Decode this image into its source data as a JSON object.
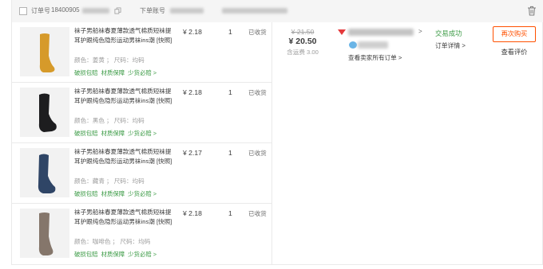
{
  "header": {
    "order_label": "订单号",
    "order_number": "18400905",
    "account_label": "下单账号"
  },
  "items": [
    {
      "title": "袜子男船袜春夏薄款透气棉质短袜提耳护跟纯色隐形运动男袜ins潮 [快照]",
      "spec": "颜色：姜黄 ； 尺码：均码",
      "price": "¥ 2.18",
      "qty": "1",
      "state": "已收货",
      "color": "#d69a2a",
      "services": [
        "破损包赔",
        "材质保障",
        "少货必赔 >"
      ]
    },
    {
      "title": "袜子男船袜春夏薄款透气棉质短袜提耳护跟纯色隐形运动男袜ins潮 [快照]",
      "spec": "颜色：黑色 ； 尺码：均码",
      "price": "¥ 2.18",
      "qty": "1",
      "state": "已收货",
      "color": "#1d1d1f",
      "services": [
        "破损包赔",
        "材质保障",
        "少货必赔 >"
      ]
    },
    {
      "title": "袜子男船袜春夏薄款透气棉质短袜提耳护跟纯色隐形运动男袜ins潮 [快照]",
      "spec": "颜色：藏青 ； 尺码：均码",
      "price": "¥ 2.17",
      "qty": "1",
      "state": "已收货",
      "color": "#2f4566",
      "services": [
        "破损包赔",
        "材质保障",
        "少货必赔 >"
      ]
    },
    {
      "title": "袜子男船袜春夏薄款透气棉质短袜提耳护跟纯色隐形运动男袜ins潮 [快照]",
      "spec": "颜色：咖啡色 ； 尺码：均码",
      "price": "¥ 2.18",
      "qty": "1",
      "state": "已收货",
      "color": "#85766b",
      "services": [
        "破损包赔",
        "材质保障",
        "少货必赔 >"
      ]
    }
  ],
  "totals": {
    "original": "¥ 21.50",
    "paid": "¥ 20.50",
    "freight": "含运费 3.00"
  },
  "seller": {
    "chevron": ">",
    "all_orders": "查看卖家所有订单 >"
  },
  "status": {
    "text": "交易成功",
    "detail": "订单详情 >"
  },
  "actions": {
    "rebuy": "再次购买",
    "review": "查看评价"
  },
  "icons": {
    "copy": "copy-icon",
    "trash": "trash-icon",
    "seller_logo": "store-logo-icon",
    "wangwang": "chat-icon"
  },
  "colors": {
    "accent": "#ff5000",
    "success": "#3c9b46"
  }
}
